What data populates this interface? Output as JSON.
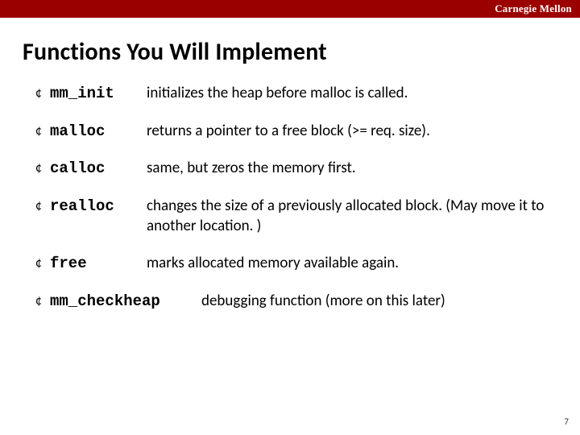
{
  "header": {
    "brand": "Carnegie Mellon"
  },
  "title": "Functions You Will Implement",
  "items": [
    {
      "fn": "mm_init",
      "desc": "initializes the heap before malloc is called."
    },
    {
      "fn": "malloc",
      "desc": "returns a pointer to a free block (>= req. size)."
    },
    {
      "fn": "calloc",
      "desc": "same, but zeros the memory first."
    },
    {
      "fn": "realloc",
      "desc": "changes the size of a previously allocated block. (May move it to another location. )"
    },
    {
      "fn": "free",
      "desc": "marks allocated memory available again."
    },
    {
      "fn": "mm_checkheap",
      "desc": "debugging function (more on this later)",
      "wide": true
    }
  ],
  "bullet_glyph": "¢",
  "page_number": "7"
}
